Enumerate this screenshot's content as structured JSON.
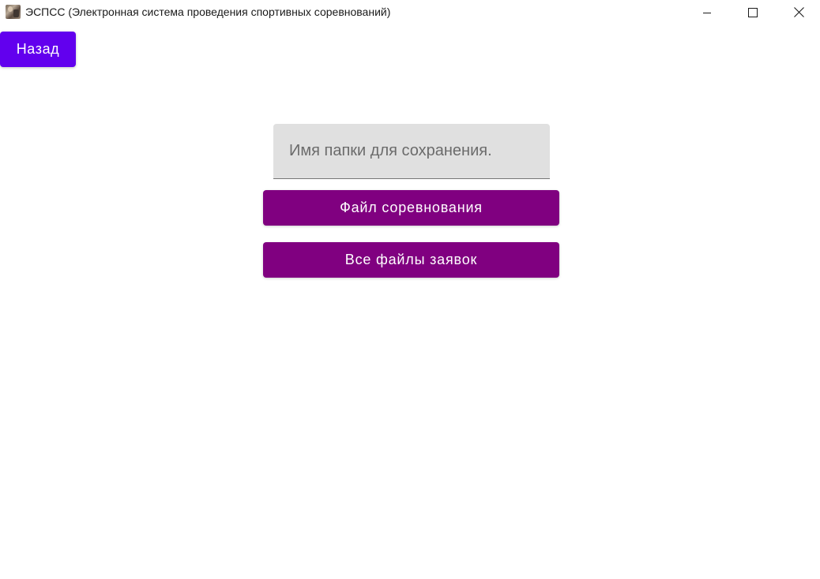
{
  "window": {
    "title": "ЭСПСС (Электронная система проведения спортивных соревнований)",
    "icon": "app-photo-icon",
    "controls": {
      "minimize": "minimize-icon",
      "maximize": "maximize-icon",
      "close": "close-icon"
    }
  },
  "toolbar": {
    "back_label": "Назад"
  },
  "form": {
    "folder_input": {
      "value": "",
      "placeholder": "Имя папки для сохранения."
    },
    "competition_file_label": "Файл соревнования",
    "all_applications_label": "Все файлы заявок"
  },
  "colors": {
    "back_button": "#6200ee",
    "action_buttons": "#800080",
    "input_background": "#e0e0e0",
    "button_text": "#ffffff"
  }
}
